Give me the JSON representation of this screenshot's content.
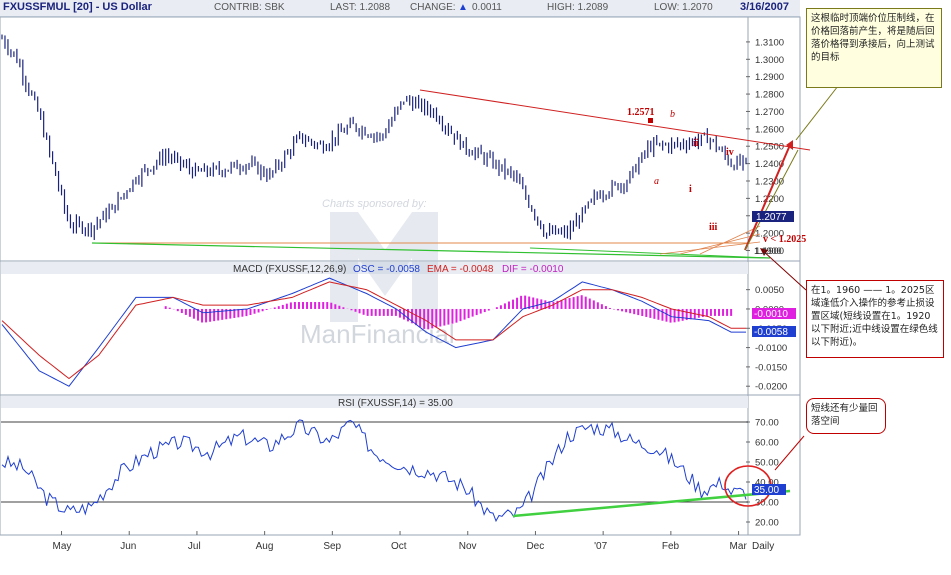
{
  "header": {
    "symbol": "FXUSSFMUL [20] - US Dollar",
    "contrib": "CONTRIB: SBK",
    "last": "LAST: 1.2088",
    "change_label": "CHANGE:",
    "change_arrow": "▲",
    "change_value": "0.0011",
    "high": "HIGH: 1.2089",
    "low": "LOW: 1.2070",
    "date": "3/16/2007"
  },
  "colors": {
    "price": "#1a237e",
    "macd": "#1f3fd0",
    "signal": "#d02020",
    "hist": "#e020e0",
    "rsi": "#1f3fd0",
    "trend_red": "#d02020",
    "trend_green": "#30c030"
  },
  "watermark": {
    "sponsor": "Charts sponsored by:",
    "brand": "ManFinancial"
  },
  "chart_data": [
    {
      "type": "line",
      "panel": "price",
      "title": "FXUSSFMUL [20] - US Dollar",
      "x_ticks": [
        "May",
        "Jun",
        "Jul",
        "Aug",
        "Sep",
        "Oct",
        "Nov",
        "Dec",
        "'07",
        "Feb",
        "Mar",
        "Daily"
      ],
      "y_ticks": [
        "1.3100",
        "1.3000",
        "1.2900",
        "1.2800",
        "1.2700",
        "1.2600",
        "1.2500",
        "1.2400",
        "1.2300",
        "1.2200",
        "1.2100",
        "1.2000",
        "1.1900"
      ],
      "ylim": [
        1.188,
        1.318
      ],
      "series": [
        {
          "name": "FXUSSFMUL",
          "x": [
            0,
            2,
            5,
            9,
            12,
            15,
            18,
            22,
            26,
            29,
            33,
            36,
            40,
            43,
            47,
            51,
            54,
            58,
            62,
            65,
            69,
            73,
            76,
            80,
            84,
            87,
            91,
            95,
            98
          ],
          "values": [
            1.312,
            1.3,
            1.268,
            1.205,
            1.203,
            1.215,
            1.232,
            1.245,
            1.235,
            1.236,
            1.24,
            1.233,
            1.255,
            1.25,
            1.262,
            1.255,
            1.277,
            1.27,
            1.25,
            1.243,
            1.232,
            1.2,
            1.2,
            1.222,
            1.23,
            1.25,
            1.251,
            1.255,
            1.24
          ]
        }
      ],
      "last_value": "1.2077",
      "annotations": [
        "1.2571",
        "b",
        "ii",
        "iv",
        "a",
        "i",
        "iii",
        "v < 1.2025",
        "1.1900"
      ]
    },
    {
      "type": "line",
      "panel": "macd",
      "title": "MACD (FXUSSF,12,26,9)",
      "osc": "OSC = -0.0058",
      "ema": "EMA = -0.0048",
      "dif": "DIF = -0.0010",
      "y_ticks": [
        "0.0050",
        "0.0000",
        "-0.0050",
        "-0.0100",
        "-0.0150",
        "-0.0200"
      ],
      "ylim": [
        -0.0215,
        0.0075
      ],
      "series": [
        {
          "name": "MACD",
          "x": [
            0,
            5,
            9,
            13,
            18,
            23,
            27,
            33,
            39,
            44,
            49,
            53,
            57,
            61,
            66,
            70,
            74,
            78,
            82,
            86,
            90,
            95,
            98
          ],
          "values": [
            -0.004,
            -0.016,
            -0.02,
            -0.01,
            0.003,
            0.003,
            -0.001,
            0.0,
            0.004,
            0.008,
            0.004,
            0.0,
            -0.006,
            -0.01,
            -0.008,
            0.0,
            0.002,
            0.007,
            0.005,
            0.002,
            -0.002,
            -0.003,
            -0.006
          ]
        },
        {
          "name": "EMA",
          "x": [
            0,
            5,
            9,
            13,
            18,
            23,
            27,
            33,
            39,
            44,
            49,
            53,
            57,
            61,
            66,
            70,
            74,
            78,
            82,
            86,
            90,
            95,
            98
          ],
          "values": [
            -0.003,
            -0.012,
            -0.018,
            -0.012,
            0.001,
            0.003,
            0.001,
            0.001,
            0.003,
            0.007,
            0.005,
            0.001,
            -0.003,
            -0.008,
            -0.008,
            -0.002,
            0.001,
            0.005,
            0.005,
            0.003,
            0.0,
            -0.002,
            -0.005
          ]
        }
      ],
      "last_values": [
        "-0.0010",
        "-0.0058"
      ]
    },
    {
      "type": "line",
      "panel": "rsi",
      "title": "RSI (FXUSSF,14) = 35.00",
      "y_ticks": [
        "70.00",
        "60.00",
        "50.00",
        "40.00",
        "30.00",
        "20.00"
      ],
      "ylim": [
        16,
        75
      ],
      "series": [
        {
          "name": "RSI",
          "x": [
            0,
            3,
            6,
            9,
            12,
            16,
            20,
            24,
            28,
            32,
            36,
            40,
            44,
            47,
            50,
            54,
            58,
            62,
            66,
            69,
            70,
            73,
            76,
            79,
            82,
            85,
            88,
            91,
            94,
            97,
            98
          ],
          "values": [
            50,
            47,
            32,
            25,
            28,
            45,
            55,
            60,
            55,
            63,
            58,
            68,
            60,
            70,
            55,
            48,
            45,
            38,
            22,
            24,
            27,
            45,
            63,
            68,
            66,
            60,
            57,
            48,
            36,
            40,
            35
          ]
        }
      ],
      "last_value": "35.00"
    }
  ],
  "callouts": {
    "top": "这根临时顶端价位压制线，在价格回落前产生，将是随后回落价格得到承接后，向上测试的目标",
    "mid": "在1。1960 —— 1。2025区域逢低介入操作的参考止损设置区域(短线设置在1。1920以下附近;近中线设置在绿色线以下附近)。",
    "rsi": "短线还有少量回落空间"
  }
}
